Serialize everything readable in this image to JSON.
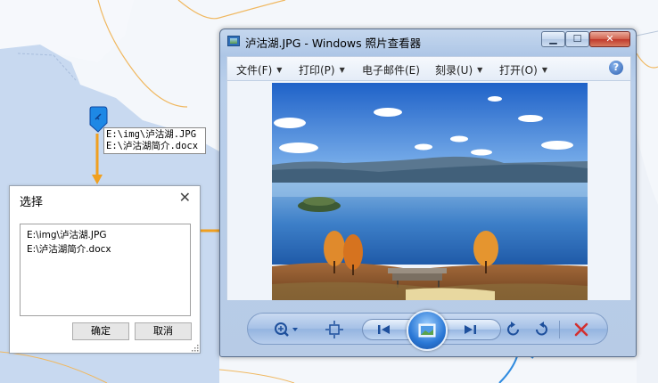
{
  "callout": {
    "lines": [
      "E:\\img\\泸沽湖.JPG",
      "E:\\泸沽湖简介.docx"
    ]
  },
  "select_dialog": {
    "title": "选择",
    "close_glyph": "✕",
    "items": [
      "E:\\img\\泸沽湖.JPG",
      "E:\\泸沽湖简介.docx"
    ],
    "ok_label": "确定",
    "cancel_label": "取消"
  },
  "viewer": {
    "title": "泸沽湖.JPG - Windows 照片查看器",
    "caption_buttons": {
      "minimize": "▁",
      "maximize": "☐",
      "close": "✕"
    },
    "menus": [
      {
        "label": "文件(F)",
        "has_dropdown": true
      },
      {
        "label": "打印(P)",
        "has_dropdown": true
      },
      {
        "label": "电子邮件(E)",
        "has_dropdown": false
      },
      {
        "label": "刻录(U)",
        "has_dropdown": true
      },
      {
        "label": "打开(O)",
        "has_dropdown": true
      }
    ],
    "help_glyph": "?",
    "controls": [
      "zoom-icon",
      "fit-window-icon",
      "previous-icon",
      "slideshow-icon",
      "next-icon",
      "rotate-left-icon",
      "rotate-right-icon",
      "delete-icon"
    ]
  },
  "colors": {
    "arrow": "#f0a020",
    "marker": "#1e88e5",
    "delete": "#d32f2f",
    "map_water": "#c9daf0",
    "map_land": "#f3f6fb"
  }
}
